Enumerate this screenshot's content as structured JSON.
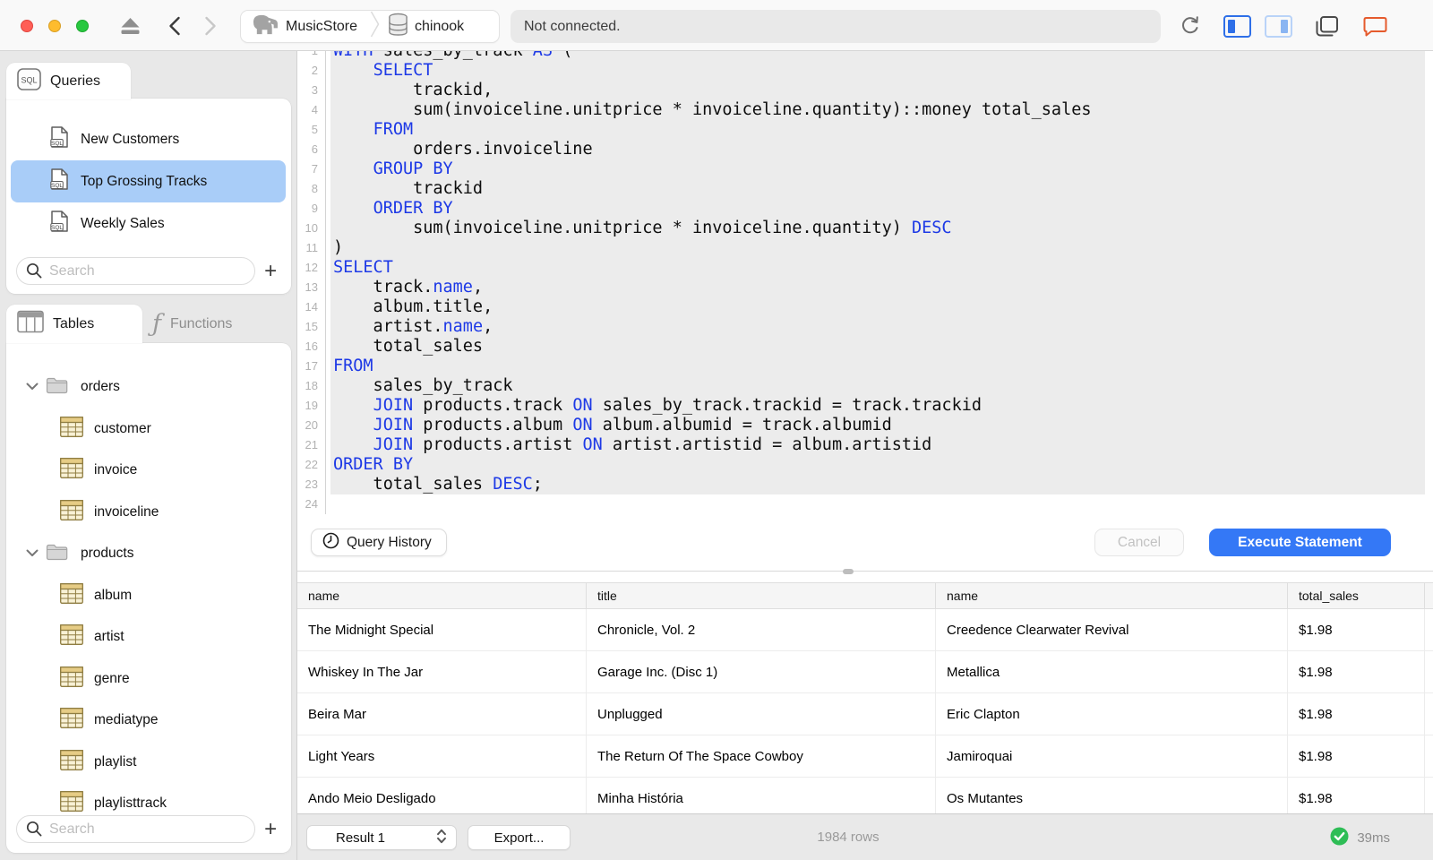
{
  "titlebar": {
    "window_controls": [
      "close",
      "minimize",
      "zoom"
    ],
    "nav_icons": [
      "eject-icon",
      "back-icon",
      "forward-icon"
    ],
    "breadcrumb": {
      "connection": "MusicStore",
      "connection_icon": "elephant-icon",
      "database": "chinook",
      "database_icon": "database-icon"
    },
    "status": "Not connected.",
    "right_icons": [
      "refresh-icon",
      "sidebar-left-icon",
      "sidebar-right-icon",
      "windows-icon",
      "chat-icon"
    ]
  },
  "queries_panel": {
    "tab_label": "Queries",
    "tab_icon": "sql-badge-icon",
    "items": [
      {
        "label": "New Customers",
        "selected": false
      },
      {
        "label": "Top Grossing Tracks",
        "selected": true
      },
      {
        "label": "Weekly Sales",
        "selected": false
      }
    ],
    "search_placeholder": "Search",
    "add_label": "+"
  },
  "schema_panel": {
    "tabs": [
      {
        "label": "Tables",
        "icon": "table-grid-icon",
        "selected": true
      },
      {
        "label": "Functions",
        "icon": "function-icon",
        "selected": false
      }
    ],
    "tree": [
      {
        "type": "folder",
        "label": "orders",
        "expanded": true
      },
      {
        "type": "table",
        "label": "customer"
      },
      {
        "type": "table",
        "label": "invoice"
      },
      {
        "type": "table",
        "label": "invoiceline"
      },
      {
        "type": "folder",
        "label": "products",
        "expanded": true
      },
      {
        "type": "table",
        "label": "album"
      },
      {
        "type": "table",
        "label": "artist"
      },
      {
        "type": "table",
        "label": "genre"
      },
      {
        "type": "table",
        "label": "mediatype"
      },
      {
        "type": "table",
        "label": "playlist"
      },
      {
        "type": "table",
        "label": "playlisttrack"
      }
    ],
    "search_placeholder": "Search",
    "add_label": "+"
  },
  "editor": {
    "keyword_color": "#1d39e6",
    "statement_highlight_color": "#ececec",
    "lines": [
      {
        "n": 1,
        "segs": [
          [
            "WITH",
            1
          ],
          [
            " sales_by_track ",
            0
          ],
          [
            "AS",
            1
          ],
          [
            " (",
            0
          ]
        ]
      },
      {
        "n": 2,
        "segs": [
          [
            "    ",
            0
          ],
          [
            "SELECT",
            1
          ]
        ]
      },
      {
        "n": 3,
        "segs": [
          [
            "        trackid,",
            0
          ]
        ]
      },
      {
        "n": 4,
        "segs": [
          [
            "        sum(invoiceline.unitprice * invoiceline.quantity)::money total_sales",
            0
          ]
        ]
      },
      {
        "n": 5,
        "segs": [
          [
            "    ",
            0
          ],
          [
            "FROM",
            1
          ]
        ]
      },
      {
        "n": 6,
        "segs": [
          [
            "        orders.invoiceline",
            0
          ]
        ]
      },
      {
        "n": 7,
        "segs": [
          [
            "    ",
            0
          ],
          [
            "GROUP BY",
            1
          ]
        ]
      },
      {
        "n": 8,
        "segs": [
          [
            "        trackid",
            0
          ]
        ]
      },
      {
        "n": 9,
        "segs": [
          [
            "    ",
            0
          ],
          [
            "ORDER BY",
            1
          ]
        ]
      },
      {
        "n": 10,
        "segs": [
          [
            "        sum(invoiceline.unitprice * invoiceline.quantity) ",
            0
          ],
          [
            "DESC",
            1
          ]
        ]
      },
      {
        "n": 11,
        "segs": [
          [
            ")",
            0
          ]
        ]
      },
      {
        "n": 12,
        "segs": [
          [
            "SELECT",
            1
          ]
        ]
      },
      {
        "n": 13,
        "segs": [
          [
            "    track.",
            0
          ],
          [
            "name",
            1
          ],
          [
            ",",
            0
          ]
        ]
      },
      {
        "n": 14,
        "segs": [
          [
            "    album.title,",
            0
          ]
        ]
      },
      {
        "n": 15,
        "segs": [
          [
            "    artist.",
            0
          ],
          [
            "name",
            1
          ],
          [
            ",",
            0
          ]
        ]
      },
      {
        "n": 16,
        "segs": [
          [
            "    total_sales",
            0
          ]
        ]
      },
      {
        "n": 17,
        "segs": [
          [
            "FROM",
            1
          ]
        ]
      },
      {
        "n": 18,
        "segs": [
          [
            "    sales_by_track",
            0
          ]
        ]
      },
      {
        "n": 19,
        "segs": [
          [
            "    ",
            0
          ],
          [
            "JOIN",
            1
          ],
          [
            " products.track ",
            0
          ],
          [
            "ON",
            1
          ],
          [
            " sales_by_track.trackid = track.trackid",
            0
          ]
        ]
      },
      {
        "n": 20,
        "segs": [
          [
            "    ",
            0
          ],
          [
            "JOIN",
            1
          ],
          [
            " products.album ",
            0
          ],
          [
            "ON",
            1
          ],
          [
            " album.albumid = track.albumid",
            0
          ]
        ]
      },
      {
        "n": 21,
        "segs": [
          [
            "    ",
            0
          ],
          [
            "JOIN",
            1
          ],
          [
            " products.artist ",
            0
          ],
          [
            "ON",
            1
          ],
          [
            " artist.artistid = album.artistid",
            0
          ]
        ]
      },
      {
        "n": 22,
        "segs": [
          [
            "ORDER BY",
            1
          ]
        ]
      },
      {
        "n": 23,
        "segs": [
          [
            "    total_sales ",
            0
          ],
          [
            "DESC",
            1
          ],
          [
            ";",
            0
          ]
        ]
      },
      {
        "n": 24,
        "segs": []
      }
    ]
  },
  "actions": {
    "query_history_label": "Query History",
    "query_history_icon": "clock-icon",
    "cancel_label": "Cancel",
    "execute_label": "Execute Statement",
    "execute_color": "#3478f6"
  },
  "results": {
    "columns": [
      "name",
      "title",
      "name",
      "total_sales"
    ],
    "rows": [
      [
        "The Midnight Special",
        "Chronicle, Vol. 2",
        "Creedence Clearwater Revival",
        "$1.98"
      ],
      [
        "Whiskey In The Jar",
        "Garage Inc. (Disc 1)",
        "Metallica",
        "$1.98"
      ],
      [
        "Beira Mar",
        "Unplugged",
        "Eric Clapton",
        "$1.98"
      ],
      [
        "Light Years",
        "The Return Of The Space Cowboy",
        "Jamiroquai",
        "$1.98"
      ],
      [
        "Ando Meio Desligado",
        "Minha História",
        "Os Mutantes",
        "$1.98"
      ]
    ]
  },
  "statusbar": {
    "result_selector": "Result 1",
    "result_selector_icon": "stepper-icon",
    "export_label": "Export...",
    "row_count": "1984 rows",
    "status_icon": "success-check-icon",
    "status_color": "#2ebd56",
    "duration": "39ms"
  }
}
